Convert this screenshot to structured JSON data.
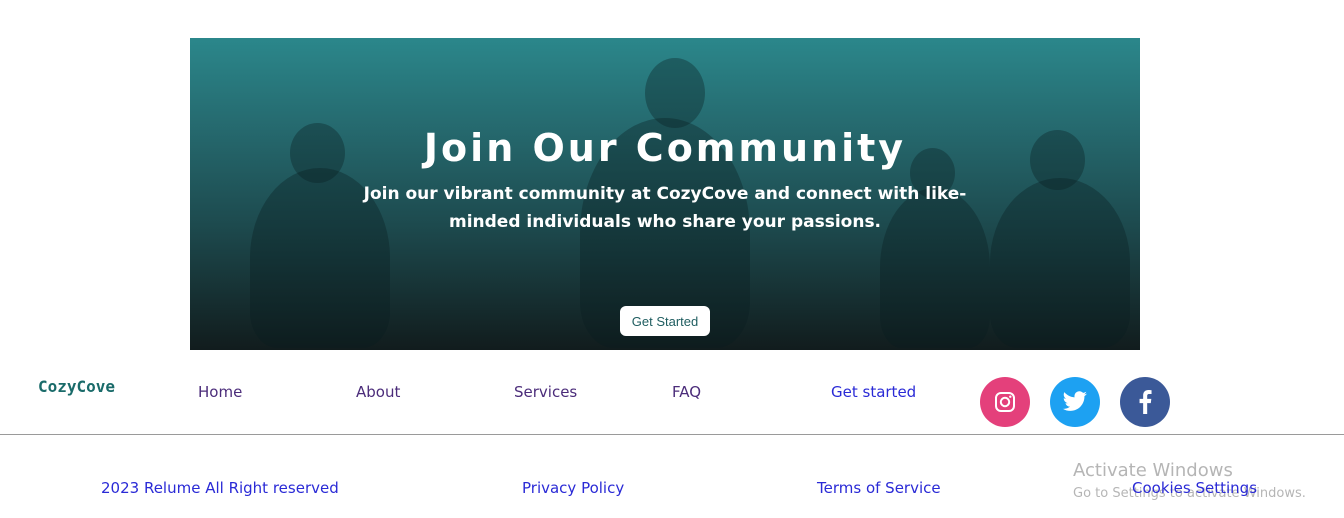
{
  "hero": {
    "title": "Join Our Community",
    "subtitle": "Join our vibrant community at CozyCove and connect with like-minded individuals who share your passions.",
    "cta_label": "Get Started"
  },
  "footer": {
    "logo": "CozyCove",
    "nav": [
      {
        "label": "Home"
      },
      {
        "label": "About"
      },
      {
        "label": "Services"
      },
      {
        "label": "FAQ"
      },
      {
        "label": "Get started"
      }
    ],
    "social": [
      {
        "name": "instagram-icon",
        "color": "#e4407b"
      },
      {
        "name": "twitter-icon",
        "color": "#1da1f2"
      },
      {
        "name": "facebook-icon",
        "color": "#3b5998"
      }
    ],
    "bottom_links": [
      {
        "label": "2023 Relume All Right reserved"
      },
      {
        "label": "Privacy Policy"
      },
      {
        "label": "Terms of Service"
      },
      {
        "label": "Cookies Settings"
      }
    ]
  },
  "os_watermark": {
    "title": "Activate Windows",
    "subtitle": "Go to Settings to activate Windows."
  },
  "colors": {
    "accent_teal": "#2b878b",
    "link_blue": "#2a2ad6",
    "link_purple": "#4b2c7a"
  }
}
